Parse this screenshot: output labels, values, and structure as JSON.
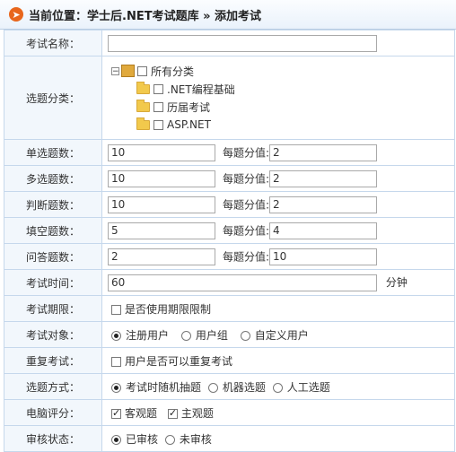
{
  "header": {
    "title": "当前位置：学士后.NET考试题库 » 添加考试"
  },
  "exam_name": {
    "label": "考试名称：",
    "value": ""
  },
  "category": {
    "label": "选题分类：",
    "root": "所有分类",
    "children": [
      ".NET编程基础",
      "历届考试",
      "ASP.NET"
    ]
  },
  "single": {
    "label": "单选题数：",
    "count": "10",
    "score_label": "每题分值:",
    "score": "2"
  },
  "multi": {
    "label": "多选题数：",
    "count": "10",
    "score_label": "每题分值:",
    "score": "2"
  },
  "judge": {
    "label": "判断题数：",
    "count": "10",
    "score_label": "每题分值:",
    "score": "2"
  },
  "fill": {
    "label": "填空题数：",
    "count": "5",
    "score_label": "每题分值:",
    "score": "4"
  },
  "qa": {
    "label": "问答题数：",
    "count": "2",
    "score_label": "每题分值:",
    "score": "10"
  },
  "time": {
    "label": "考试时间：",
    "value": "60",
    "unit": "分钟"
  },
  "period": {
    "label": "考试期限：",
    "checkbox": "是否使用期限限制"
  },
  "target": {
    "label": "考试对象：",
    "options": [
      "注册用户",
      "用户组",
      "自定义用户"
    ],
    "selected": 0
  },
  "repeat": {
    "label": "重复考试：",
    "checkbox": "用户是否可以重复考试"
  },
  "mode": {
    "label": "选题方式：",
    "options": [
      "考试时随机抽题",
      "机器选题",
      "人工选题"
    ],
    "selected": 0
  },
  "grading": {
    "label": "电脑评分：",
    "options": [
      "客观题",
      "主观题"
    ]
  },
  "audit": {
    "label": "审核状态：",
    "options": [
      "已审核",
      "未审核"
    ],
    "selected": 0
  }
}
